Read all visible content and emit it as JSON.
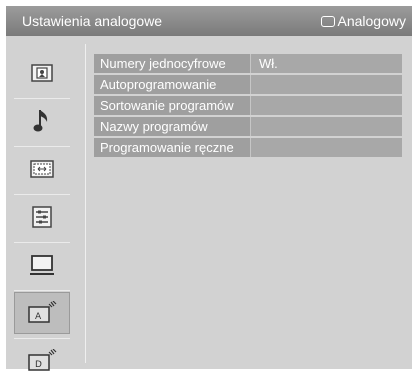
{
  "header": {
    "title": "Ustawienia analogowe",
    "source_label": "Analogowy",
    "source_icon": "tv-source-icon"
  },
  "sidebar": {
    "items": [
      {
        "icon": "picture-icon",
        "selected": false
      },
      {
        "icon": "music-note-icon",
        "selected": false
      },
      {
        "icon": "screen-icon",
        "selected": false
      },
      {
        "icon": "settings-list-icon",
        "selected": false
      },
      {
        "icon": "monitor-icon",
        "selected": false
      },
      {
        "icon": "analog-setup-icon",
        "selected": true
      },
      {
        "icon": "digital-setup-icon",
        "selected": false
      }
    ]
  },
  "menu": {
    "items": [
      {
        "label": "Numery jednocyfrowe",
        "value": "Wł."
      },
      {
        "label": "Autoprogramowanie",
        "value": ""
      },
      {
        "label": "Sortowanie programów",
        "value": ""
      },
      {
        "label": "Nazwy programów",
        "value": ""
      },
      {
        "label": "Programowanie ręczne",
        "value": ""
      }
    ]
  },
  "colors": {
    "background": "#d2d2d2",
    "header": "#8a8a8a",
    "menu_row": "#9f9f9f",
    "text": "#ffffff"
  }
}
